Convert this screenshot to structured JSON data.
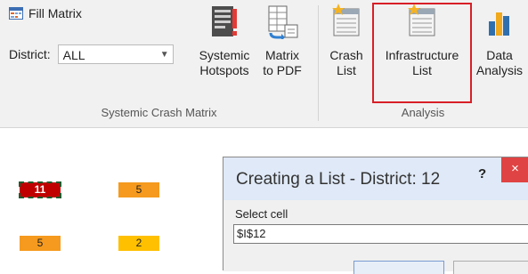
{
  "ribbon": {
    "fill_matrix_label": "Fill Matrix",
    "district_label": "District:",
    "district_value": "ALL",
    "systemic_hotspots": [
      "Systemic",
      "Hotspots"
    ],
    "matrix_to_pdf": [
      "Matrix",
      "to PDF"
    ],
    "crash_list": [
      "Crash",
      "List"
    ],
    "infrastructure_list": [
      "Infrastructure",
      "List"
    ],
    "data_analysis": [
      "Data",
      "Analysis"
    ],
    "group_systemic": "Systemic Crash Matrix",
    "group_analysis": "Analysis",
    "selected_color": "#d81f26"
  },
  "sheet": {
    "cells": [
      "11",
      "5",
      "5",
      "2"
    ]
  },
  "dialog": {
    "title": "Creating a List - District: 12",
    "help": "?",
    "close": "×",
    "select_label": "Select cell",
    "input_value": "$I$12"
  }
}
